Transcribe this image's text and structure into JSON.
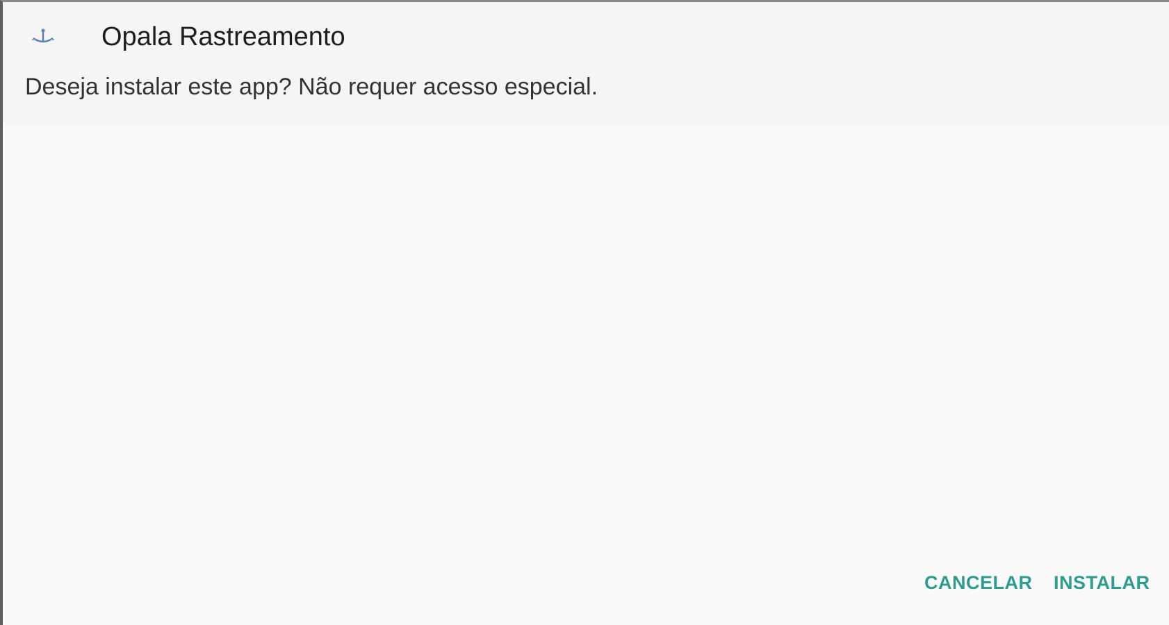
{
  "dialog": {
    "app_name": "Opala Rastreamento",
    "app_icon": "anchor-app-icon",
    "message": "Deseja instalar este app? Não requer acesso especial."
  },
  "actions": {
    "cancel_label": "CANCELAR",
    "install_label": "INSTALAR"
  },
  "colors": {
    "accent": "#2e9c8f",
    "header_bg": "#f5f5f5",
    "body_bg": "#fafafa"
  }
}
